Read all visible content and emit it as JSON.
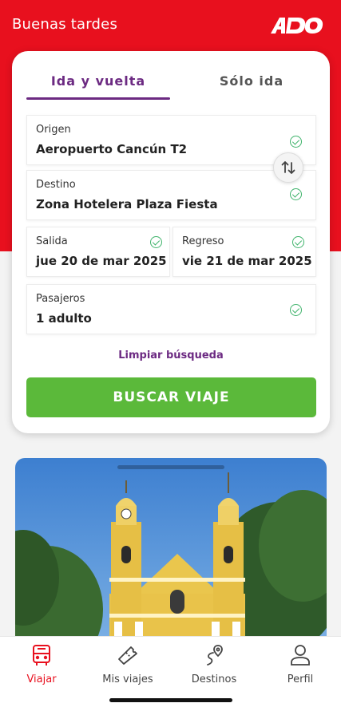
{
  "header": {
    "greeting": "Buenas tardes",
    "brand": "ADO",
    "brand_color": "#e8101e"
  },
  "tabs": {
    "round_trip": "Ida y vuelta",
    "one_way": "Sólo ida",
    "active": "round_trip"
  },
  "form": {
    "origin": {
      "label": "Origen",
      "value": "Aeropuerto Cancún T2",
      "icon": "check-circle-icon"
    },
    "destination": {
      "label": "Destino",
      "value": "Zona Hotelera Plaza Fiesta",
      "icon": "check-circle-icon"
    },
    "swap_icon": "swap-arrows-icon",
    "departure": {
      "label": "Salida",
      "value": "jue 20 de mar 2025",
      "icon": "check-circle-icon"
    },
    "return": {
      "label": "Regreso",
      "value": "vie 21 de mar 2025",
      "icon": "check-circle-icon"
    },
    "passengers": {
      "label": "Pasajeros",
      "value": "1 adulto",
      "icon": "check-circle-icon"
    },
    "clear_label": "Limpiar búsqueda",
    "search_label": "BUSCAR VIAJE",
    "accent_color": "#6c2a82",
    "button_color": "#5bb93a"
  },
  "promo": {
    "image": "yellow church with two bell towers under blue sky"
  },
  "bottom_nav": [
    {
      "label": "Viajar",
      "icon": "bus-icon",
      "active": true
    },
    {
      "label": "Mis viajes",
      "icon": "ticket-icon",
      "active": false
    },
    {
      "label": "Destinos",
      "icon": "route-pin-icon",
      "active": false
    },
    {
      "label": "Perfil",
      "icon": "user-icon",
      "active": false
    }
  ]
}
